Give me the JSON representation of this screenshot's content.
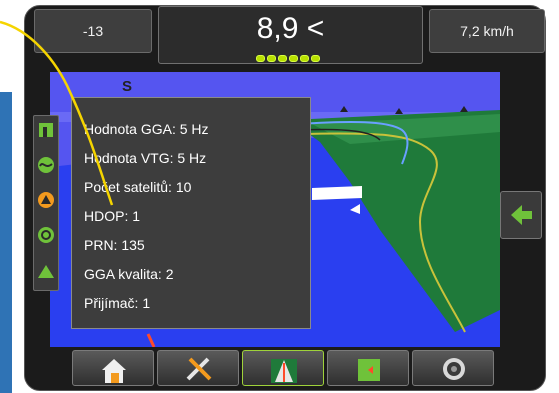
{
  "top_bar": {
    "cross_track": "-13",
    "heading_value": "8,9 <",
    "speed": "7,2 km/h",
    "satellite_leds": 6
  },
  "map": {
    "north_label": "S"
  },
  "gps_info": {
    "lines": [
      "Hodnota GGA: 5 Hz",
      "Hodnota VTG: 5 Hz",
      "Počet satelitů: 10",
      "HDOP: 1",
      "PRN: 135",
      "GGA kvalita: 2",
      "Přijímač: 1"
    ]
  },
  "colors": {
    "sky": "#5555f0",
    "field": "#1f7a3a",
    "water": "#2a3ff0",
    "accent_green": "#6fc23a",
    "callout": "#f5d400",
    "led": "#b8e000"
  },
  "icons": {
    "left_column": [
      "boundary-icon",
      "steering-icon",
      "warning-icon",
      "gps-icon",
      "guidance-mode-icon"
    ],
    "right_button": "green-arrow-left-icon",
    "toolbar": [
      "home-icon",
      "tools-icon",
      "guidance-icon",
      "field-icon",
      "camera-icon"
    ]
  }
}
